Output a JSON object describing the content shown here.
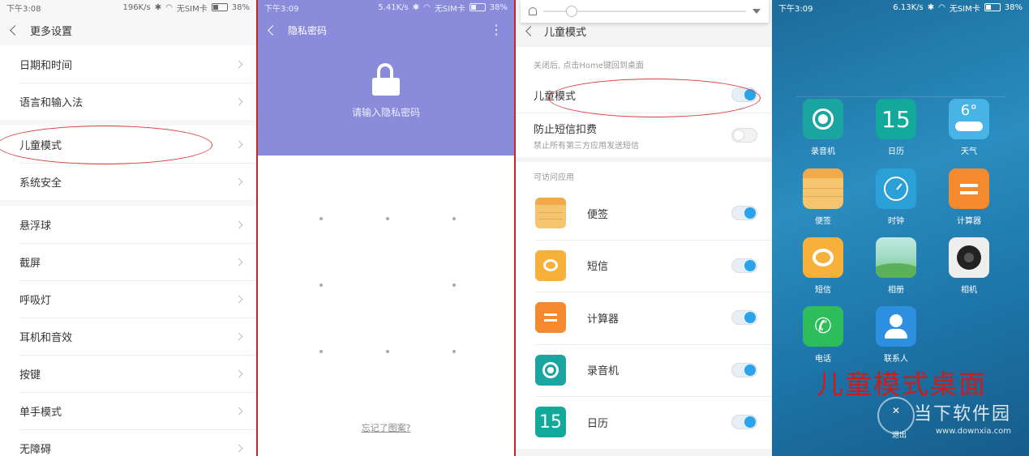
{
  "p1": {
    "status": {
      "time": "下午3:08",
      "speed": "196K/s",
      "sim": "无SIM卡",
      "battery": "38%"
    },
    "title": "更多设置",
    "groups": [
      [
        "日期和时间",
        "语言和输入法"
      ],
      [
        "儿童模式",
        "系统安全"
      ],
      [
        "悬浮球",
        "截屏",
        "呼吸灯",
        "耳机和音效",
        "按键",
        "单手模式",
        "无障碍"
      ]
    ]
  },
  "p2": {
    "status": {
      "time": "下午3:09",
      "speed": "5.41K/s",
      "sim": "无SIM卡",
      "battery": "38%"
    },
    "title": "隐私密码",
    "hint": "请输入隐私密码",
    "forgot": "忘记了图案?"
  },
  "p3": {
    "title": "儿童模式",
    "note": "关闭后, 点击Home键回到桌面",
    "kid_mode": "儿童模式",
    "sms_block": "防止短信扣费",
    "sms_block_sub": "禁止所有第三方应用发送短信",
    "section": "可访问应用",
    "apps": [
      {
        "label": "便签",
        "icon": "notes-icon",
        "color": "#f5c46f"
      },
      {
        "label": "短信",
        "icon": "sms-icon",
        "color": "#f7b13a"
      },
      {
        "label": "计算器",
        "icon": "calculator-icon",
        "color": "#f5892e"
      },
      {
        "label": "录音机",
        "icon": "recorder-icon",
        "color": "#1aa5a0"
      },
      {
        "label": "日历",
        "icon": "calendar-icon",
        "color": "#12a89a"
      }
    ],
    "calendar_day": "15"
  },
  "p4": {
    "status": {
      "time": "下午3:09",
      "speed": "6.13K/s",
      "sim": "无SIM卡",
      "battery": "38%"
    },
    "apps": [
      {
        "label": "录音机",
        "icon": "recorder-icon",
        "color": "#1aa5a0"
      },
      {
        "label": "日历",
        "icon": "calendar-icon",
        "color": "#12a89a"
      },
      {
        "label": "天气",
        "icon": "weather-icon",
        "color": "#47b3e6"
      },
      {
        "label": "便签",
        "icon": "notes-icon",
        "color": "#f5c46f"
      },
      {
        "label": "时钟",
        "icon": "clock-icon",
        "color": "#2ba0d6"
      },
      {
        "label": "计算器",
        "icon": "calculator-icon",
        "color": "#f5892e"
      },
      {
        "label": "短信",
        "icon": "sms-icon",
        "color": "#f7b13a"
      },
      {
        "label": "相册",
        "icon": "gallery-icon",
        "color": "#8fd08a"
      },
      {
        "label": "相机",
        "icon": "camera-icon",
        "color": "#eeeeee"
      },
      {
        "label": "电话",
        "icon": "phone-icon",
        "color": "#2ebd5b"
      },
      {
        "label": "联系人",
        "icon": "contacts-icon",
        "color": "#2d8fe0"
      }
    ],
    "calendar_day": "15",
    "weather_temp": "6°",
    "caption": "儿童模式桌面",
    "exit_label": "退出",
    "watermark": "当下软件园",
    "watermark_url": "www.downxia.com"
  },
  "accent": "#2aa3e8",
  "highlight": "#d93a3a"
}
